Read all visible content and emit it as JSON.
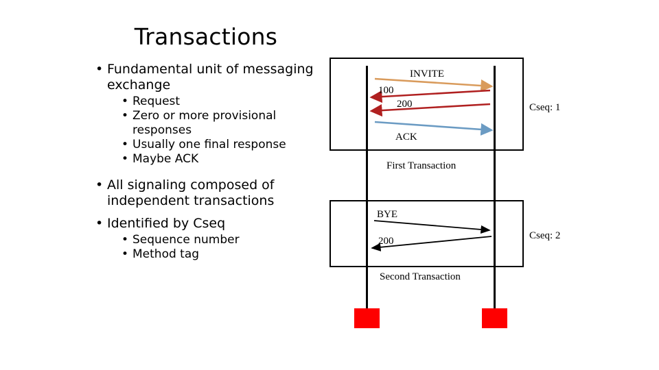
{
  "slide": {
    "title": "Transactions",
    "background": "#ffffff"
  },
  "content": {
    "bullets": [
      {
        "level": 1,
        "marker": "•",
        "text": "Fundamental unit of messaging exchange"
      },
      {
        "level": 2,
        "marker": "•",
        "text": "Request"
      },
      {
        "level": 2,
        "marker": "•",
        "text": "Zero or more provisional responses"
      },
      {
        "level": 2,
        "marker": "•",
        "text": "Usually one final response"
      },
      {
        "level": 2,
        "marker": "•",
        "text": "Maybe ACK"
      },
      {
        "level": 1,
        "marker": "•",
        "text": "All signaling composed of independent transactions"
      },
      {
        "level": 1,
        "marker": "•",
        "text": "Identified by Cseq"
      },
      {
        "level": 2,
        "marker": "•",
        "text": "Sequence number"
      },
      {
        "level": 2,
        "marker": "•",
        "text": "Method tag"
      }
    ]
  },
  "diagram": {
    "colors": {
      "invite_arrow": "#d99b5c",
      "response_arrow": "#b02020",
      "ack_arrow": "#6b9bc3",
      "lifeline": "#000000",
      "terminator": "#fe0000",
      "box_border": "#000000"
    },
    "first_transaction": {
      "caption": "First Transaction",
      "cseq": "Cseq: 1",
      "messages": [
        {
          "label": "INVITE",
          "direction": "right",
          "color": "#d99b5c"
        },
        {
          "label": "100",
          "direction": "left",
          "color": "#b02020"
        },
        {
          "label": "200",
          "direction": "left",
          "color": "#b02020"
        },
        {
          "label": "ACK",
          "direction": "right",
          "color": "#6b9bc3"
        }
      ]
    },
    "second_transaction": {
      "caption": "Second Transaction",
      "cseq": "Cseq: 2",
      "messages": [
        {
          "label": "BYE",
          "direction": "right",
          "color": "#000000"
        },
        {
          "label": "200",
          "direction": "left",
          "color": "#000000"
        }
      ]
    }
  }
}
